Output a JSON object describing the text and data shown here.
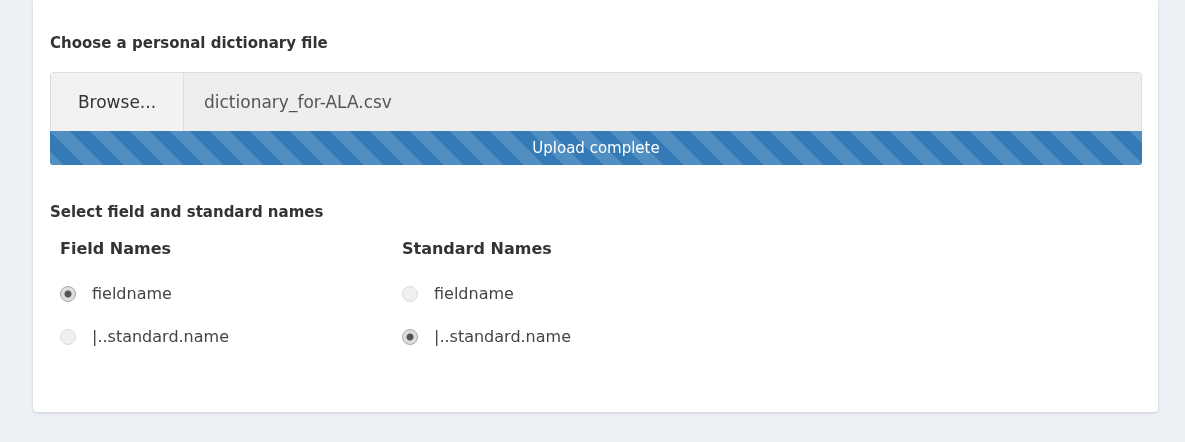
{
  "file_input": {
    "label": "Choose a personal dictionary file",
    "button": "Browse...",
    "value": "dictionary_for-ALA.csv"
  },
  "upload_progress": {
    "level": 1,
    "text": "Upload complete"
  },
  "selection": {
    "title": "Select field and standard names",
    "groups": [
      {
        "label": "Field Names",
        "options": [
          {
            "label": "fieldname",
            "selected": true
          },
          {
            "label": "|..standard.name",
            "selected": false
          }
        ]
      },
      {
        "label": "Standard Names",
        "options": [
          {
            "label": "fieldname",
            "selected": false
          },
          {
            "label": "|..standard.name",
            "selected": true
          }
        ]
      }
    ]
  }
}
